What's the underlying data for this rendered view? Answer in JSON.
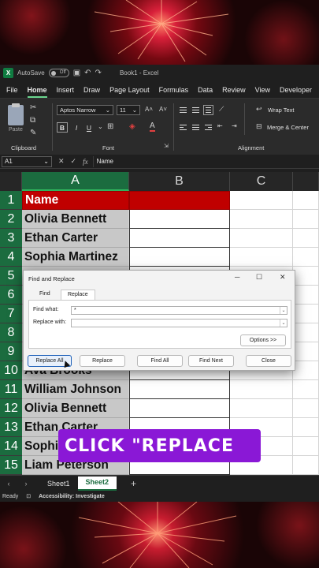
{
  "window": {
    "autosave_label": "AutoSave",
    "autosave_state": "Off",
    "doc_title": "Book1 - Excel"
  },
  "ribbon_tabs": [
    "File",
    "Home",
    "Insert",
    "Draw",
    "Page Layout",
    "Formulas",
    "Data",
    "Review",
    "View",
    "Developer"
  ],
  "ribbon": {
    "paste_label": "Paste",
    "clipboard_label": "Clipboard",
    "font_name": "Aptos Narrow",
    "font_size": "11",
    "font_label": "Font",
    "bold": "B",
    "italic": "I",
    "underline": "U",
    "wrap_text": "Wrap Text",
    "merge_center": "Merge & Center",
    "alignment_label": "Alignment"
  },
  "formula_bar": {
    "cell_ref": "A1",
    "fx": "fx",
    "content": "Name"
  },
  "columns": [
    "A",
    "B",
    "C"
  ],
  "rows": [
    {
      "n": "1",
      "a": "Name"
    },
    {
      "n": "2",
      "a": "Olivia Bennett"
    },
    {
      "n": "3",
      "a": "Ethan Carter"
    },
    {
      "n": "4",
      "a": "Sophia Martinez"
    },
    {
      "n": "5",
      "a": ""
    },
    {
      "n": "6",
      "a": ""
    },
    {
      "n": "7",
      "a": ""
    },
    {
      "n": "8",
      "a": ""
    },
    {
      "n": "9",
      "a": ""
    },
    {
      "n": "10",
      "a": "Ava Brooks"
    },
    {
      "n": "11",
      "a": "William Johnson"
    },
    {
      "n": "12",
      "a": "Olivia Bennett"
    },
    {
      "n": "13",
      "a": "Ethan Carter"
    },
    {
      "n": "14",
      "a": "Sophi"
    },
    {
      "n": "15",
      "a": "Liam Peterson"
    }
  ],
  "sheets": [
    "Sheet1",
    "Sheet2"
  ],
  "status": {
    "ready": "Ready",
    "accessibility": "Accessibility: Investigate"
  },
  "dialog": {
    "title": "Find and Replace",
    "tab_find": "Find",
    "tab_replace": "Replace",
    "find_label": "Find what:",
    "find_value": "*",
    "replace_label": "Replace with:",
    "replace_value": "",
    "options_button": "Options >>",
    "replace_all": "Replace All",
    "replace": "Replace",
    "find_all": "Find All",
    "find_next": "Find Next",
    "close": "Close"
  },
  "caption": "CLICK \"REPLACE",
  "colors": {
    "header_fill": "#c00000",
    "excel_green": "#1b6c3f",
    "caption_bg": "#8a18d6"
  }
}
